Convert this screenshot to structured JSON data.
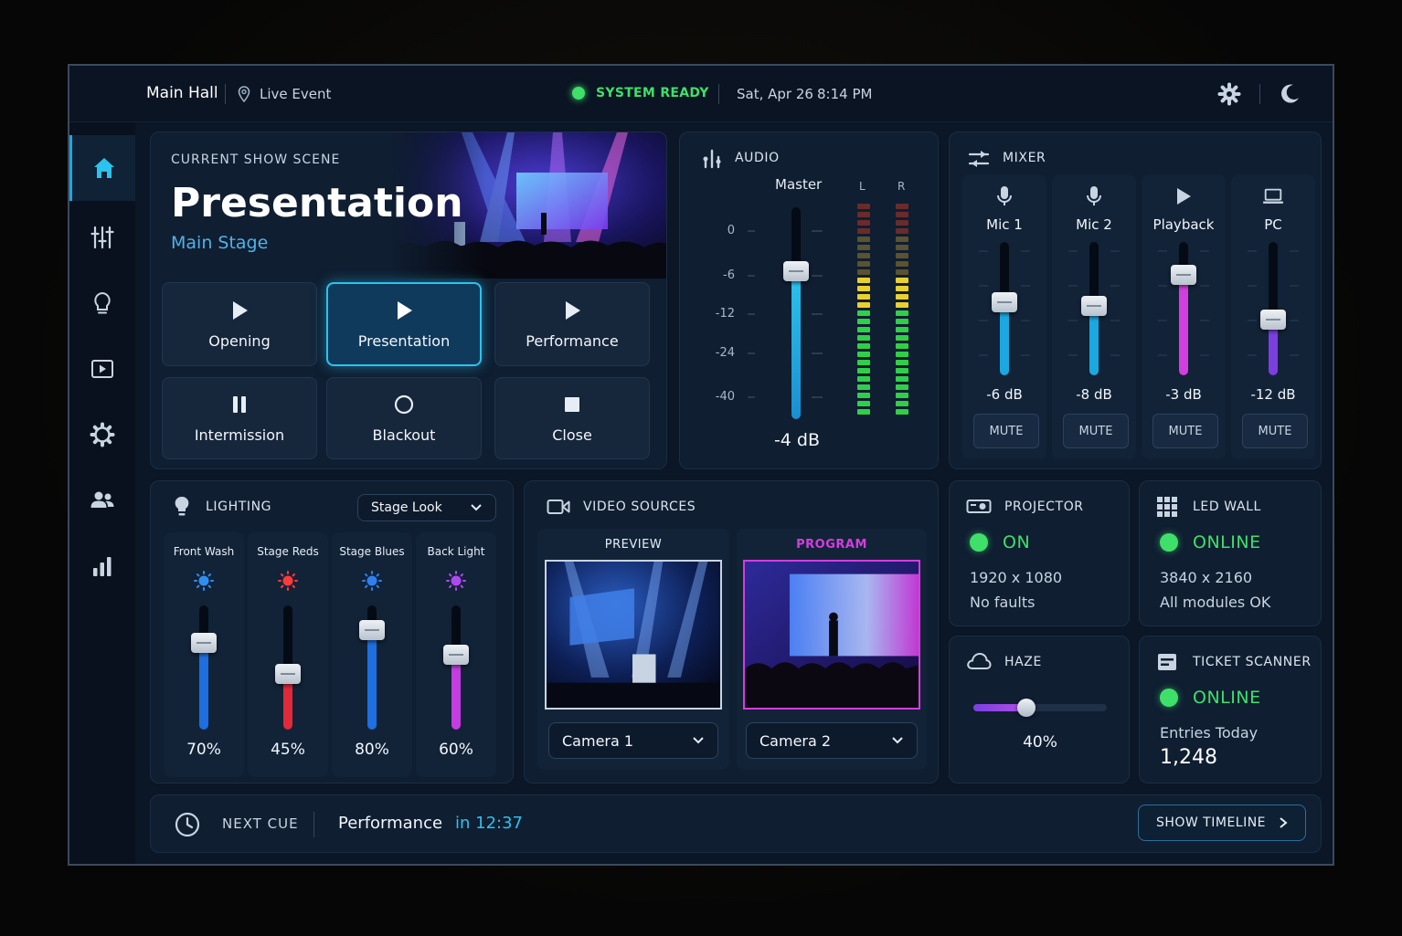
{
  "topbar": {
    "venue": "Main Hall",
    "event": "Live Event",
    "status": "SYSTEM READY",
    "date": "Sat, Apr 26",
    "time": "8:14 PM"
  },
  "sidebar": {
    "items": [
      "home-icon",
      "sliders-icon",
      "bulb-icon",
      "play-screen-icon",
      "gear-icon",
      "users-icon",
      "chart-icon"
    ],
    "active": "home-icon"
  },
  "scene": {
    "label": "CURRENT SHOW SCENE",
    "name": "Presentation",
    "location": "Main Stage",
    "buttons": [
      {
        "label": "Opening",
        "icon": "play-icon"
      },
      {
        "label": "Presentation",
        "icon": "play-icon",
        "active": true
      },
      {
        "label": "Performance",
        "icon": "play-icon"
      },
      {
        "label": "Intermission",
        "icon": "pause-icon"
      },
      {
        "label": "Blackout",
        "icon": "circle-icon"
      },
      {
        "label": "Close",
        "icon": "stop-icon"
      }
    ]
  },
  "audio": {
    "title": "AUDIO",
    "master_label": "Master",
    "left_label": "L",
    "right_label": "R",
    "scale": [
      "0",
      "-6",
      "-12",
      "-24",
      "-40"
    ],
    "master_value": "-4 dB",
    "master_level": 0.7
  },
  "mixer": {
    "title": "MIXER",
    "mute_label": "MUTE",
    "channels": [
      {
        "name": "Mic 1",
        "icon": "mic-icon",
        "value": "-6 dB",
        "level": 0.55,
        "color": "#1ba8e0"
      },
      {
        "name": "Mic 2",
        "icon": "mic-icon",
        "value": "-8 dB",
        "level": 0.52,
        "color": "#1ba8e0"
      },
      {
        "name": "Playback",
        "icon": "play-icon",
        "value": "-3 dB",
        "level": 0.75,
        "color": "#d43de0"
      },
      {
        "name": "PC",
        "icon": "laptop-icon",
        "value": "-12 dB",
        "level": 0.42,
        "color": "#7b3fe0"
      }
    ]
  },
  "lighting": {
    "title": "LIGHTING",
    "preset": "Stage Look",
    "channels": [
      {
        "name": "Front Wash",
        "value": "70%",
        "level": 0.7,
        "color": "#1e6fe0",
        "icon_color": "#2f8ff0"
      },
      {
        "name": "Stage Reds",
        "value": "45%",
        "level": 0.45,
        "color": "#e02a3a",
        "icon_color": "#ff3b3b"
      },
      {
        "name": "Stage Blues",
        "value": "80%",
        "level": 0.8,
        "color": "#1e6fe0",
        "icon_color": "#2f7ff0"
      },
      {
        "name": "Back Light",
        "value": "60%",
        "level": 0.6,
        "color": "#c43de0",
        "icon_color": "#b048f0"
      }
    ]
  },
  "video": {
    "title": "VIDEO SOURCES",
    "preview_label": "PREVIEW",
    "program_label": "PROGRAM",
    "preview_source": "Camera 1",
    "program_source": "Camera 2"
  },
  "projector": {
    "title": "PROJECTOR",
    "status": "ON",
    "resolution": "1920 x 1080",
    "faults": "No faults"
  },
  "ledwall": {
    "title": "LED WALL",
    "status": "ONLINE",
    "resolution": "3840 x 2160",
    "modules": "All modules OK"
  },
  "haze": {
    "title": "HAZE",
    "value": "40%",
    "level": 0.4
  },
  "tickets": {
    "title": "TICKET SCANNER",
    "status": "ONLINE",
    "entries_label": "Entries Today",
    "entries": "1,248"
  },
  "cue": {
    "label": "NEXT CUE",
    "name": "Performance",
    "countdown": "in 12:37",
    "timeline_button": "SHOW TIMELINE"
  },
  "colors": {
    "accent": "#2bc3ee",
    "ok": "#3ee06a",
    "program": "#d43de0"
  }
}
